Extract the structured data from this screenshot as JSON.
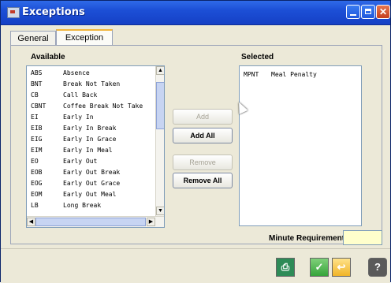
{
  "window": {
    "title": "Exceptions"
  },
  "tabs": [
    {
      "label": "General",
      "active": false
    },
    {
      "label": "Exception",
      "active": true
    }
  ],
  "available": {
    "label": "Available",
    "items": [
      {
        "code": "ABS",
        "desc": "Absence"
      },
      {
        "code": "BNT",
        "desc": "Break Not Taken"
      },
      {
        "code": "CB",
        "desc": "Call Back"
      },
      {
        "code": "CBNT",
        "desc": "Coffee Break Not Take"
      },
      {
        "code": "EI",
        "desc": "Early In"
      },
      {
        "code": "EIB",
        "desc": "Early In Break"
      },
      {
        "code": "EIG",
        "desc": "Early In Grace"
      },
      {
        "code": "EIM",
        "desc": "Early In Meal"
      },
      {
        "code": "EO",
        "desc": "Early Out"
      },
      {
        "code": "EOB",
        "desc": "Early Out Break"
      },
      {
        "code": "EOG",
        "desc": "Early Out Grace"
      },
      {
        "code": "EOM",
        "desc": "Early Out Meal"
      },
      {
        "code": "LB",
        "desc": "Long Break"
      }
    ]
  },
  "selected": {
    "label": "Selected",
    "items": [
      {
        "code": "MPNT",
        "desc": "Meal Penalty"
      }
    ]
  },
  "buttons": {
    "add": "Add",
    "add_all": "Add All",
    "remove": "Remove",
    "remove_all": "Remove All"
  },
  "minute_requirement": {
    "label": "Minute Requirement",
    "value": ""
  },
  "icons": {
    "save": "save-icon",
    "ok": "check-icon",
    "cancel": "cancel-icon",
    "help": "help-icon"
  }
}
